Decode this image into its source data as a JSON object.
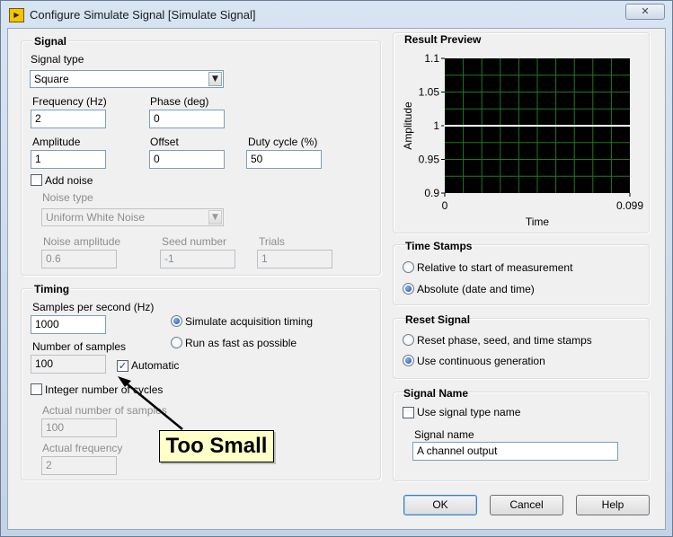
{
  "window": {
    "title": "Configure Simulate Signal [Simulate Signal]",
    "icon_text": "▶"
  },
  "signal": {
    "group_title": "Signal",
    "signal_type_label": "Signal type",
    "signal_type_value": "Square",
    "frequency_label": "Frequency (Hz)",
    "frequency_value": "2",
    "phase_label": "Phase (deg)",
    "phase_value": "0",
    "amplitude_label": "Amplitude",
    "amplitude_value": "1",
    "offset_label": "Offset",
    "offset_value": "0",
    "duty_label": "Duty cycle (%)",
    "duty_value": "50",
    "add_noise_label": "Add noise",
    "noise_type_label": "Noise type",
    "noise_type_value": "Uniform White Noise",
    "noise_amp_label": "Noise amplitude",
    "noise_amp_value": "0.6",
    "seed_label": "Seed number",
    "seed_value": "-1",
    "trials_label": "Trials",
    "trials_value": "1"
  },
  "timing": {
    "group_title": "Timing",
    "sps_label": "Samples per second (Hz)",
    "sps_value": "1000",
    "nsamples_label": "Number of samples",
    "nsamples_value": "100",
    "automatic_label": "Automatic",
    "integer_cycles_label": "Integer number of cycles",
    "actual_nsamples_label": "Actual number of samples",
    "actual_nsamples_value": "100",
    "actual_freq_label": "Actual frequency",
    "actual_freq_value": "2",
    "simulate_label": "Simulate acquisition timing",
    "fast_label": "Run as fast as possible"
  },
  "callout": {
    "text": "Too Small"
  },
  "preview": {
    "group_title": "Result Preview"
  },
  "chart_data": {
    "type": "line",
    "title": "",
    "xlabel": "Time",
    "ylabel": "Amplitude",
    "xlim": [
      0,
      0.099
    ],
    "ylim": [
      0.9,
      1.1
    ],
    "x_ticks": [
      "0",
      "0.099"
    ],
    "y_ticks": [
      "1.1",
      "1.05",
      "1",
      "0.95",
      "0.9"
    ],
    "y_tick_values": [
      1.1,
      1.05,
      1,
      0.95,
      0.9
    ],
    "grid": true,
    "series": [
      {
        "x": [
          0,
          0.099
        ],
        "values": [
          1,
          1
        ],
        "color": "#ffffff"
      }
    ],
    "background": "#000000",
    "grid_color": "#1f7a1f"
  },
  "timestamps": {
    "group_title": "Time Stamps",
    "relative_label": "Relative to start of measurement",
    "absolute_label": "Absolute (date and time)"
  },
  "reset": {
    "group_title": "Reset Signal",
    "reset_label": "Reset phase, seed, and time stamps",
    "continuous_label": "Use continuous generation"
  },
  "signame": {
    "group_title": "Signal Name",
    "use_type_label": "Use signal type name",
    "name_label": "Signal name",
    "name_value": "A channel output"
  },
  "buttons": {
    "ok": "OK",
    "cancel": "Cancel",
    "help": "Help"
  }
}
